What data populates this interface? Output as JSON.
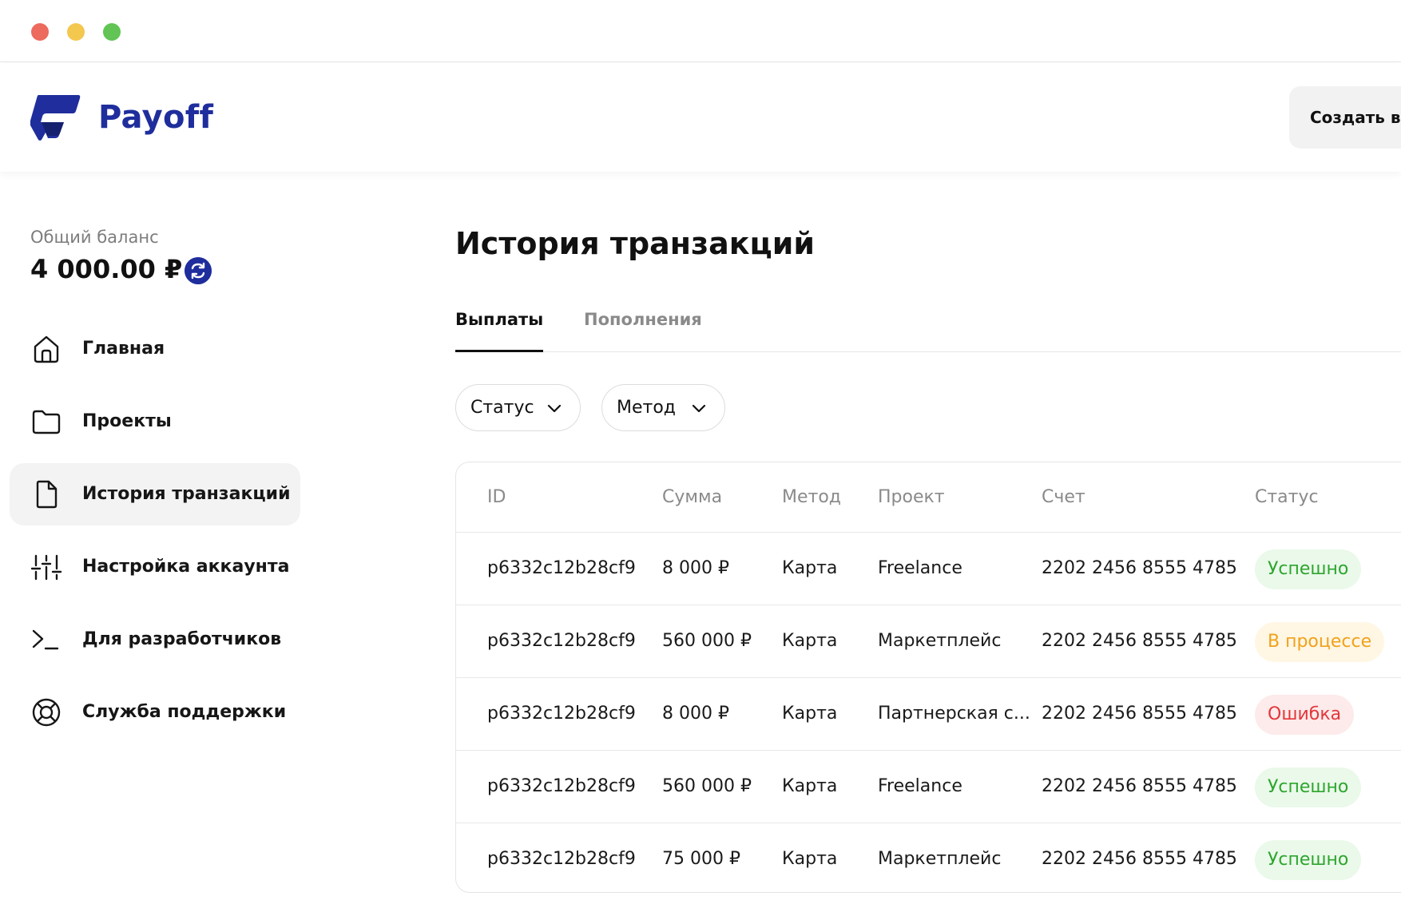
{
  "app": {
    "name": "Payoff",
    "create_button": "Создать в",
    "brand_color": "#1f2e9c"
  },
  "sidebar": {
    "balance_label": "Общий баланс",
    "balance_value": "4 000.00 ₽",
    "items": [
      {
        "label": "Главная",
        "icon": "home-icon",
        "active": false
      },
      {
        "label": "Проекты",
        "icon": "folder-icon",
        "active": false
      },
      {
        "label": "История транзакций",
        "icon": "document-icon",
        "active": true
      },
      {
        "label": "Настройка аккаунта",
        "icon": "sliders-icon",
        "active": false
      },
      {
        "label": "Для разработчиков",
        "icon": "terminal-icon",
        "active": false
      },
      {
        "label": "Служба поддержки",
        "icon": "lifebuoy-icon",
        "active": false
      }
    ]
  },
  "main": {
    "title": "История транзакций",
    "tabs": [
      {
        "label": "Выплаты",
        "active": true
      },
      {
        "label": "Пополнения",
        "active": false
      }
    ],
    "filters": [
      {
        "label": "Статус"
      },
      {
        "label": "Метод"
      }
    ],
    "table": {
      "columns": [
        "ID",
        "Сумма",
        "Метод",
        "Проект",
        "Счет",
        "Статус"
      ],
      "rows": [
        {
          "id": "p6332c12b28cf9",
          "sum": "8 000 ₽",
          "method": "Карта",
          "project": "Freelance",
          "account": "2202 2456 8555 4785",
          "status": "Успешно",
          "status_type": "success"
        },
        {
          "id": "p6332c12b28cf9",
          "sum": "560 000 ₽",
          "method": "Карта",
          "project": "Маркетплейс",
          "account": "2202 2456 8555 4785",
          "status": "В процессе",
          "status_type": "progress"
        },
        {
          "id": "p6332c12b28cf9",
          "sum": "8 000 ₽",
          "method": "Карта",
          "project": "Партнерская с...",
          "account": "2202 2456 8555 4785",
          "status": "Ошибка",
          "status_type": "error"
        },
        {
          "id": "p6332c12b28cf9",
          "sum": "560 000 ₽",
          "method": "Карта",
          "project": "Freelance",
          "account": "2202 2456 8555 4785",
          "status": "Успешно",
          "status_type": "success"
        },
        {
          "id": "p6332c12b28cf9",
          "sum": "75 000 ₽",
          "method": "Карта",
          "project": "Маркетплейс",
          "account": "2202 2456 8555 4785",
          "status": "Успешно",
          "status_type": "success"
        }
      ]
    },
    "status_colors": {
      "success": "#2ea52e",
      "progress": "#f0a21a",
      "error": "#e2363b"
    }
  }
}
